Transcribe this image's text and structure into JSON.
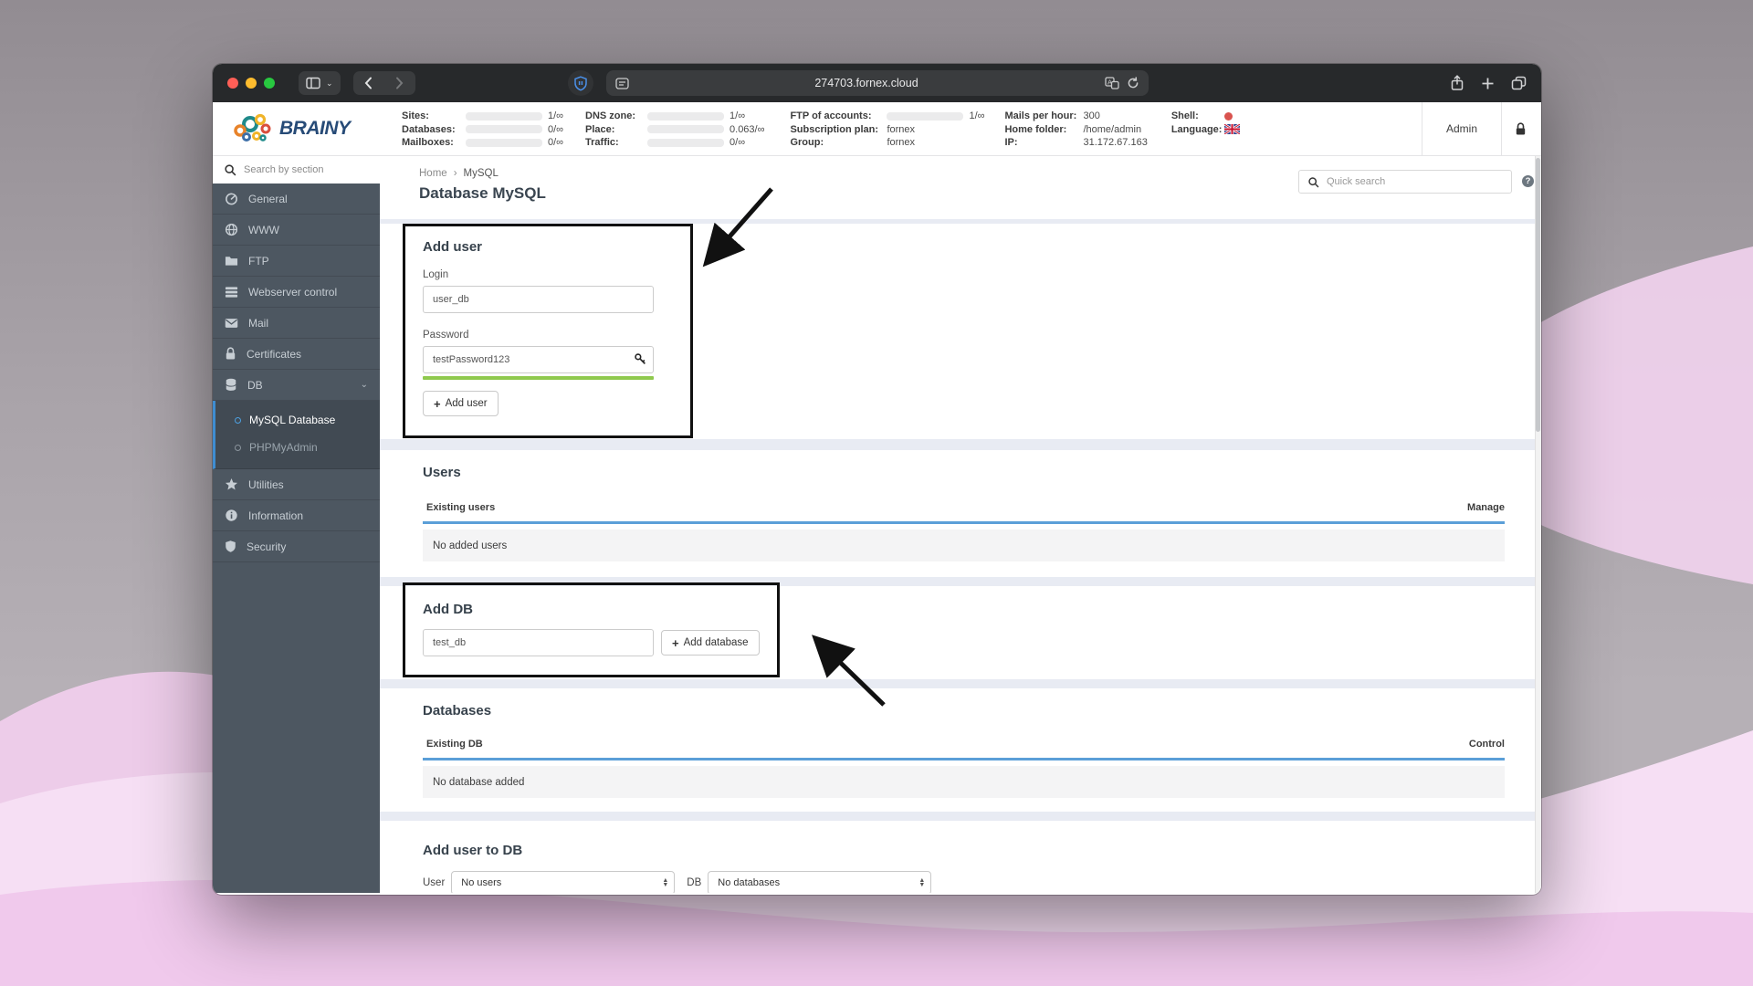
{
  "browser": {
    "url": "274703.fornex.cloud"
  },
  "header": {
    "logo_text": "BRAINY",
    "admin_label": "Admin",
    "cols": [
      {
        "rows": [
          {
            "label": "Sites:",
            "value": "1/∞"
          },
          {
            "label": "Databases:",
            "value": "0/∞"
          },
          {
            "label": "Mailboxes:",
            "value": "0/∞"
          }
        ]
      },
      {
        "rows": [
          {
            "label": "DNS zone:",
            "value": "1/∞"
          },
          {
            "label": "Place:",
            "value": "0.063/∞"
          },
          {
            "label": "Traffic:",
            "value": "0/∞"
          }
        ]
      },
      {
        "rows": [
          {
            "label": "FTP of accounts:",
            "value": "1/∞"
          },
          {
            "label": "Subscription plan:",
            "value": "fornex"
          },
          {
            "label": "Group:",
            "value": "fornex"
          }
        ]
      },
      {
        "rows": [
          {
            "label": "Mails per hour:",
            "value": "300"
          },
          {
            "label": "Home folder:",
            "value": "/home/admin"
          },
          {
            "label": "IP:",
            "value": "31.172.67.163"
          }
        ]
      },
      {
        "rows": [
          {
            "label": "Shell:",
            "value": ""
          },
          {
            "label": "Language:",
            "value": ""
          }
        ]
      }
    ]
  },
  "sidebar": {
    "search_placeholder": "Search by section",
    "items": [
      {
        "label": "General"
      },
      {
        "label": "WWW"
      },
      {
        "label": "FTP"
      },
      {
        "label": "Webserver control"
      },
      {
        "label": "Mail"
      },
      {
        "label": "Certificates"
      },
      {
        "label": "DB"
      },
      {
        "label": "Utilities"
      },
      {
        "label": "Information"
      },
      {
        "label": "Security"
      }
    ],
    "db_submenu": [
      {
        "label": "MySQL Database",
        "active": true
      },
      {
        "label": "PHPMyAdmin",
        "active": false
      }
    ]
  },
  "main": {
    "breadcrumb": {
      "home": "Home",
      "current": "MySQL"
    },
    "page_title": "Database MySQL",
    "quick_search_placeholder": "Quick search",
    "help_glyph": "?",
    "add_user": {
      "title": "Add user",
      "login_label": "Login",
      "login_value": "user_db",
      "password_label": "Password",
      "password_value": "testPassword123",
      "button_label": "Add user"
    },
    "users": {
      "title": "Users",
      "col_left": "Existing users",
      "col_right": "Manage",
      "empty": "No added users"
    },
    "add_db": {
      "title": "Add DB",
      "input_value": "test_db",
      "button_label": "Add database"
    },
    "databases": {
      "title": "Databases",
      "col_left": "Existing DB",
      "col_right": "Control",
      "empty": "No database added"
    },
    "add_user_to_db": {
      "title": "Add user to DB",
      "user_label": "User",
      "user_select_value": "No users",
      "db_label": "DB",
      "db_select_value": "No databases"
    }
  },
  "icons": {
    "plus": "+",
    "chevron_down": "⌄",
    "breadcrumb_sep": "›",
    "caret_up": "▲",
    "caret_down": "▼"
  },
  "colors": {
    "accent_blue": "#5b9fd8",
    "success_green": "#8fc94e",
    "sidebar_bg": "#4d5761",
    "submenu_border": "#3f8dd1",
    "brand_navy": "#274b77",
    "annotation_black": "#111111",
    "desktop_pink": "#f3d7f0"
  }
}
